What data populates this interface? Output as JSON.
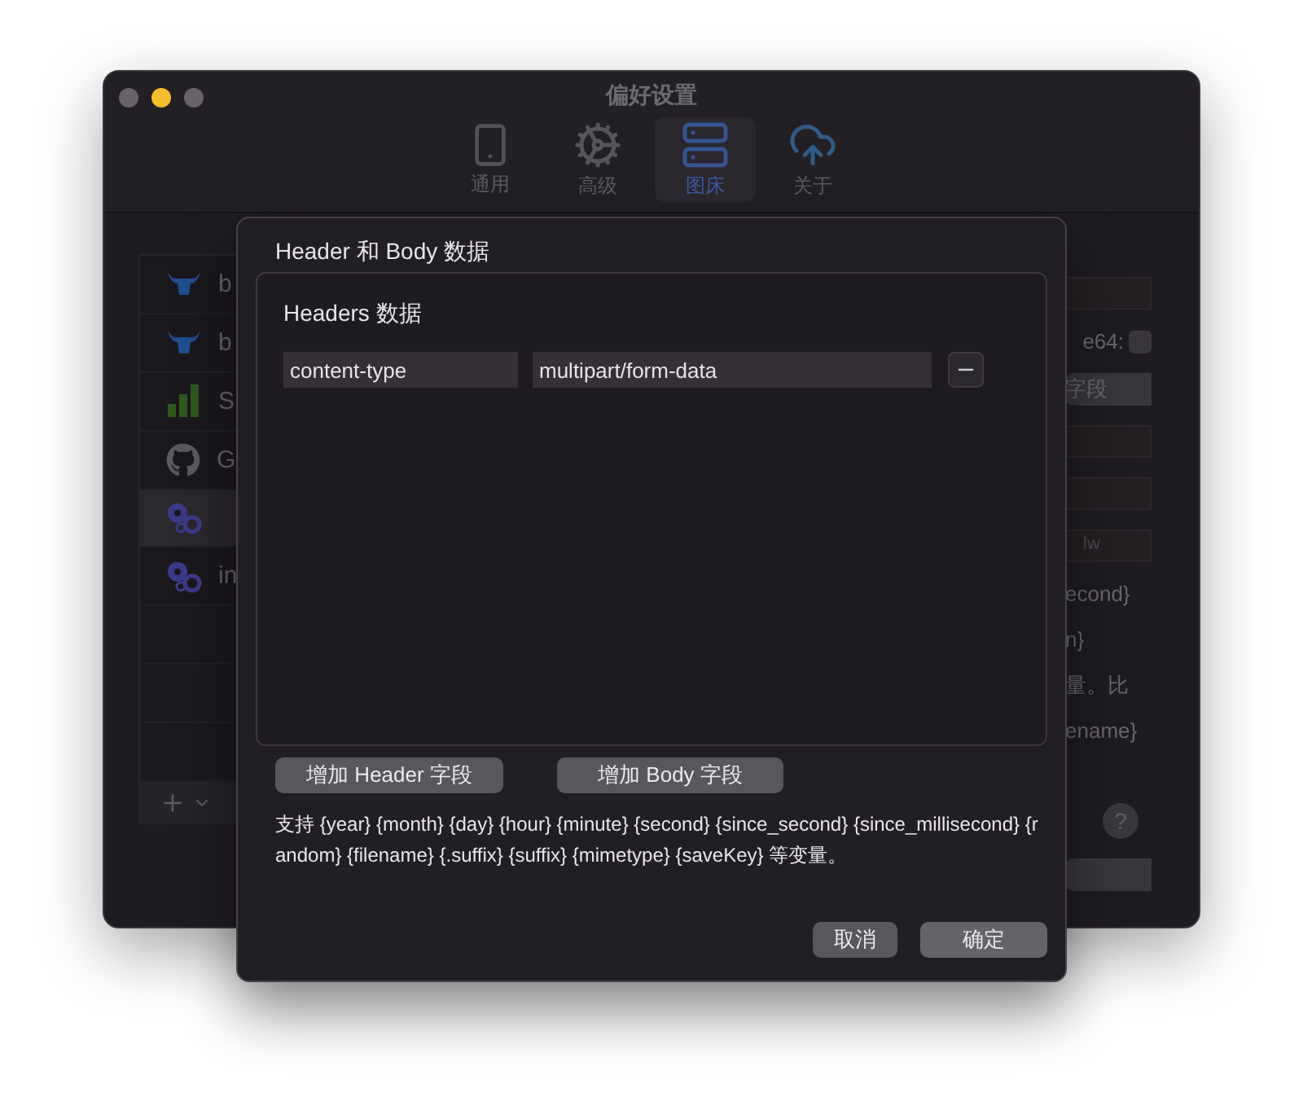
{
  "window": {
    "title": "偏好设置",
    "controls": [
      {
        "color": "#67626b"
      },
      {
        "color": "#f6bd2e"
      },
      {
        "color": "#67626b"
      }
    ]
  },
  "toolbar": [
    {
      "label": "通用",
      "kind": "general",
      "selected": false
    },
    {
      "label": "高级",
      "kind": "advanced",
      "selected": false
    },
    {
      "label": "图床",
      "kind": "hosts",
      "selected": true
    },
    {
      "label": "关于",
      "kind": "about",
      "selected": false
    }
  ],
  "sidebar": {
    "items": [
      {
        "label": "b",
        "kind": "bull",
        "selected": false
      },
      {
        "label": "b",
        "kind": "bull",
        "selected": false
      },
      {
        "label": "S",
        "kind": "bars",
        "selected": false
      },
      {
        "label": "G",
        "kind": "cat",
        "selected": false
      },
      {
        "kind": "gears",
        "selected": true
      },
      {
        "label": "in",
        "kind": "gears",
        "selected": false
      }
    ]
  },
  "settings_pane": {
    "items": [
      {
        "kind": "field"
      },
      {
        "kind": "checkbox",
        "label": "e64:",
        "checked": false
      },
      {
        "kind": "button",
        "label": "字段"
      },
      {
        "kind": "field"
      },
      {
        "kind": "field"
      },
      {
        "kind": "field",
        "value": "lw"
      },
      {
        "kind": "text",
        "lines": [
          "econd}",
          "n}",
          "量。比",
          "ename}"
        ]
      },
      {
        "kind": "help",
        "label": "?"
      },
      {
        "kind": "button"
      }
    ]
  },
  "dialog": {
    "title": "Header 和 Body 数据",
    "headers": {
      "title": "Headers 数据",
      "rows": [
        {
          "key": "content-type",
          "value": "multipart/form-data"
        }
      ]
    },
    "add_buttons": [
      "增加 Header 字段",
      "增加 Body 字段"
    ],
    "hint": "支持 {year} {month} {day} {hour} {minute} {second} {since_second} {since_millisecond} {random} {filename} {.suffix} {suffix} {mimetype} {saveKey} 等变量。",
    "buttons": [
      {
        "label": "取消",
        "kind": "secondary"
      },
      {
        "label": "确定",
        "kind": "primary"
      }
    ]
  }
}
